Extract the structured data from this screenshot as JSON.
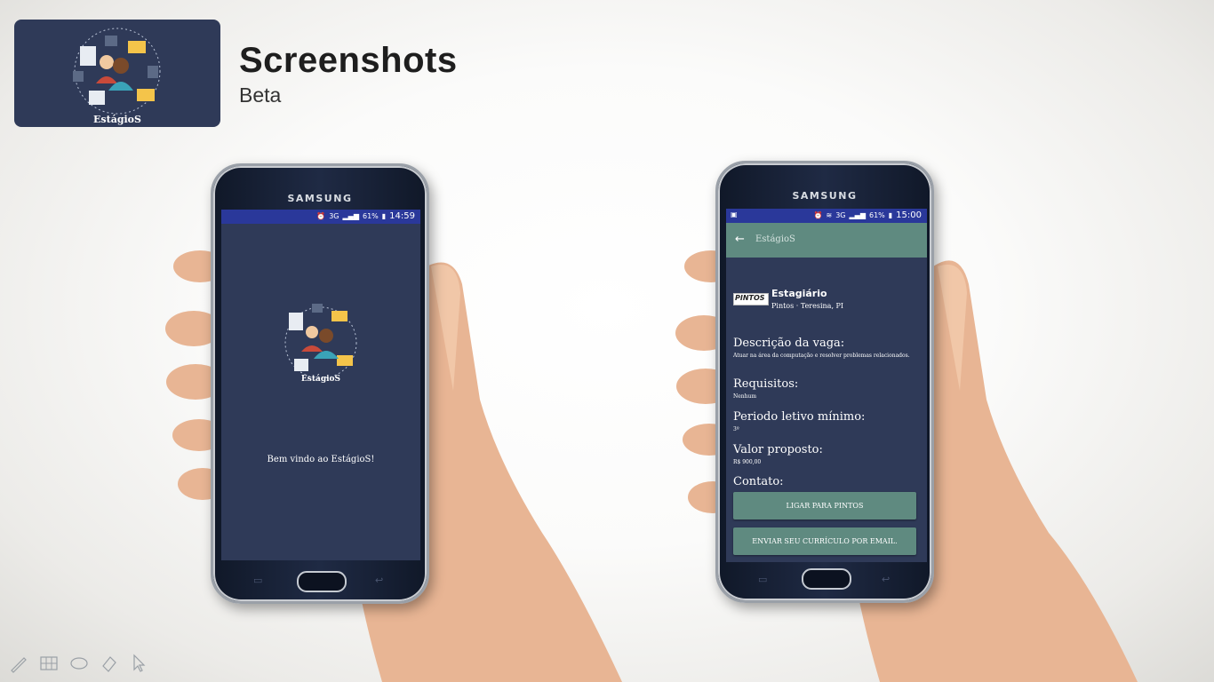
{
  "header": {
    "title": "Screenshots",
    "subtitle": "Beta",
    "logo_caption": "EstágioS"
  },
  "phone_left": {
    "brand": "SAMSUNG",
    "status": {
      "network": "3G",
      "battery": "61%",
      "time": "14:59"
    },
    "splash_caption": "EstágioS",
    "welcome_text": "Bem vindo ao EstágioS!"
  },
  "phone_right": {
    "brand": "SAMSUNG",
    "status": {
      "network": "3G",
      "battery": "61%",
      "time": "15:00"
    },
    "toolbar_title": "EstágioS",
    "company_logo_text": "PINTOS",
    "job_title": "Estagiário",
    "job_location": "Pintos · Teresina, PI",
    "description_label": "Descrição da vaga:",
    "description_value": "Atuar na área da computação e resolver problemas relacionados.",
    "requirements_label": "Requisitos:",
    "requirements_value": "Nenhum",
    "period_label": "Periodo letivo mínimo:",
    "period_value": "3º",
    "salary_label": "Valor proposto:",
    "salary_value": "R$ 900,00",
    "contact_label": "Contato:",
    "call_button": "LIGAR PARA PINTOS",
    "email_button": "ENVIAR SEU CURRÍCULO POR EMAIL."
  },
  "colors": {
    "app_bg": "#2f3a58",
    "status_bar": "#2a389a",
    "accent": "#5f8a80"
  },
  "icons": [
    "pen-icon",
    "slide-grid-icon",
    "lasso-icon",
    "eraser-icon",
    "pointer-icon"
  ]
}
